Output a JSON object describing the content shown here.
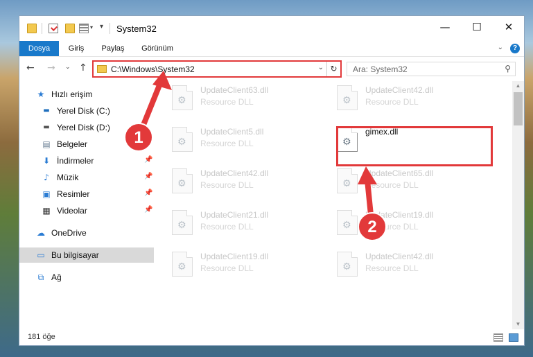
{
  "window": {
    "title": "System32"
  },
  "ribbon": {
    "tabs": [
      "Dosya",
      "Giriş",
      "Paylaş",
      "Görünüm"
    ],
    "active_tab": "Dosya"
  },
  "controls": {
    "minimize": "—",
    "maximize": "☐",
    "close": "✕",
    "help": "?"
  },
  "address": {
    "path": "C:\\Windows\\System32"
  },
  "search": {
    "placeholder": "Ara: System32"
  },
  "sidebar": {
    "items": [
      {
        "label": "Hızlı erişim",
        "icon": "star-icon",
        "pinned": false
      },
      {
        "label": "Yerel Disk (C:)",
        "icon": "windows-drive-icon",
        "pinned": false
      },
      {
        "label": "Yerel Disk (D:)",
        "icon": "drive-icon",
        "pinned": false
      },
      {
        "label": "Belgeler",
        "icon": "documents-icon",
        "pinned": true
      },
      {
        "label": "İndirmeler",
        "icon": "download-icon",
        "pinned": true
      },
      {
        "label": "Müzik",
        "icon": "music-icon",
        "pinned": true
      },
      {
        "label": "Resimler",
        "icon": "pictures-icon",
        "pinned": true
      },
      {
        "label": "Videolar",
        "icon": "videos-icon",
        "pinned": true
      },
      {
        "label": "OneDrive",
        "icon": "cloud-icon",
        "pinned": false
      },
      {
        "label": "Bu bilgisayar",
        "icon": "computer-icon",
        "pinned": false,
        "selected": true
      },
      {
        "label": "Ağ",
        "icon": "network-icon",
        "pinned": false
      }
    ]
  },
  "files": [
    {
      "name": "UpdateClient63.dll",
      "type": "Resource DLL"
    },
    {
      "name": "UpdateClient42.dll",
      "type": "Resource DLL"
    },
    {
      "name": "UpdateClient5.dll",
      "type": "Resource DLL"
    },
    {
      "name": "gimex.dll",
      "type": "",
      "highlighted": true
    },
    {
      "name": "UpdateClient42.dll",
      "type": "Resource DLL"
    },
    {
      "name": "UpdateClient65.dll",
      "type": "Resource DLL"
    },
    {
      "name": "UpdateClient21.dll",
      "type": "Resource DLL"
    },
    {
      "name": "UpdateClient19.dll",
      "type": "Resource DLL"
    },
    {
      "name": "UpdateClient19.dll",
      "type": "Resource DLL"
    },
    {
      "name": "UpdateClient42.dll",
      "type": "Resource DLL"
    }
  ],
  "status": {
    "item_count": "181 öğe"
  },
  "annotations": {
    "step1": "1",
    "step2": "2",
    "color": "#e2393a"
  }
}
